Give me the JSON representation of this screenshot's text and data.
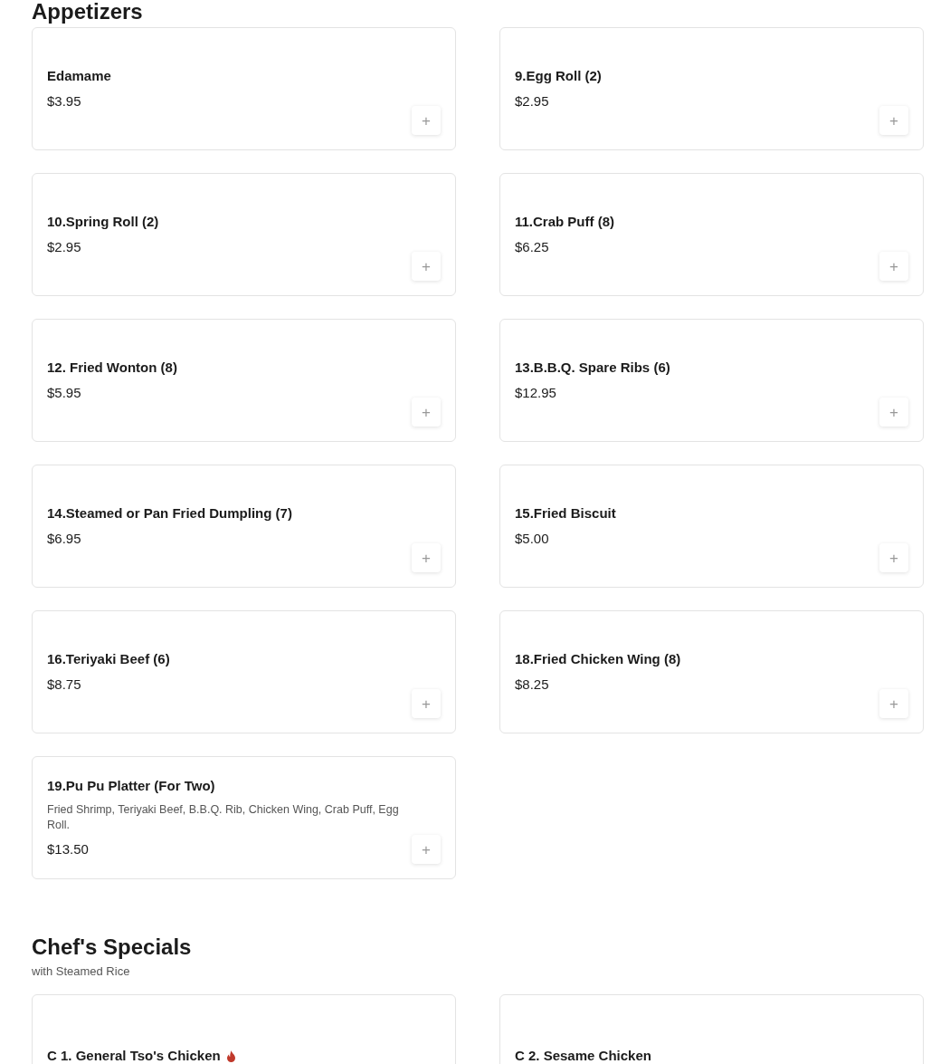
{
  "sections": [
    {
      "title": "Appetizers",
      "items": [
        {
          "name": "Edamame",
          "price": "$3.95",
          "add": "+"
        },
        {
          "name": "9.Egg Roll (2)",
          "price": "$2.95",
          "add": "+"
        },
        {
          "name": "10.Spring Roll (2)",
          "price": "$2.95",
          "add": "+"
        },
        {
          "name": "11.Crab Puff (8)",
          "price": "$6.25",
          "add": "+"
        },
        {
          "name": "12. Fried Wonton (8)",
          "price": "$5.95",
          "add": "+"
        },
        {
          "name": "13.B.B.Q. Spare Ribs (6)",
          "price": "$12.95",
          "add": "+"
        },
        {
          "name": "14.Steamed or Pan Fried Dumpling (7)",
          "price": "$6.95",
          "add": "+"
        },
        {
          "name": "15.Fried Biscuit",
          "price": "$5.00",
          "add": "+"
        },
        {
          "name": "16.Teriyaki Beef (6)",
          "price": "$8.75",
          "add": "+"
        },
        {
          "name": "18.Fried Chicken Wing (8)",
          "price": "$8.25",
          "add": "+"
        },
        {
          "name": "19.Pu Pu Platter (For Two)",
          "description": "Fried Shrimp, Teriyaki Beef, B.B.Q. Rib, Chicken Wing, Crab Puff, Egg Roll.",
          "price": "$13.50",
          "add": "+"
        }
      ]
    },
    {
      "title": "Chef's Specials",
      "subtitle": "with Steamed Rice",
      "items": [
        {
          "name": "C 1. General Tso's Chicken",
          "spicy": true
        },
        {
          "name": "C 2. Sesame Chicken",
          "spicy": false
        }
      ]
    }
  ]
}
